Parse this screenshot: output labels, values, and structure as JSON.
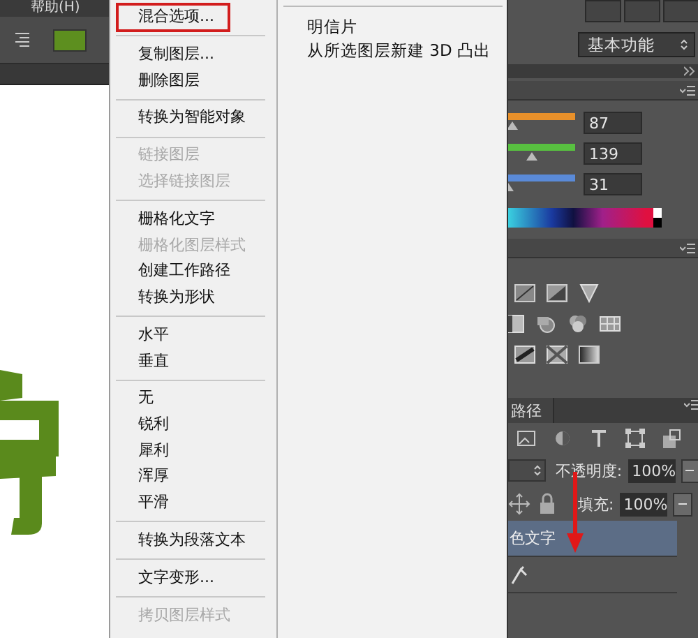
{
  "menubar": {
    "items": [
      "帮助(H)"
    ]
  },
  "context_menu": {
    "sections": [
      [
        {
          "label": "混合选项...",
          "disabled": false,
          "marked": true
        }
      ],
      [
        {
          "label": "复制图层...",
          "disabled": false,
          "marked": false
        },
        {
          "label": "删除图层",
          "disabled": false,
          "marked": false
        }
      ],
      [
        {
          "label": "转换为智能对象",
          "disabled": false,
          "marked": false
        }
      ],
      [
        {
          "label": "链接图层",
          "disabled": true,
          "marked": false
        },
        {
          "label": "选择链接图层",
          "disabled": true,
          "marked": false
        }
      ],
      [
        {
          "label": "栅格化文字",
          "disabled": false,
          "marked": false
        },
        {
          "label": "栅格化图层样式",
          "disabled": true,
          "marked": false
        },
        {
          "label": "创建工作路径",
          "disabled": false,
          "marked": false
        },
        {
          "label": "转换为形状",
          "disabled": false,
          "marked": false
        }
      ],
      [
        {
          "label": "水平",
          "disabled": false,
          "marked": false
        },
        {
          "label": "垂直",
          "disabled": false,
          "marked": false
        }
      ],
      [
        {
          "label": "无",
          "disabled": false,
          "marked": false
        },
        {
          "label": "锐利",
          "disabled": false,
          "marked": false
        },
        {
          "label": "犀利",
          "disabled": false,
          "marked": false
        },
        {
          "label": "浑厚",
          "disabled": false,
          "marked": false
        },
        {
          "label": "平滑",
          "disabled": false,
          "marked": false
        }
      ],
      [
        {
          "label": "转换为段落文本",
          "disabled": false,
          "marked": false
        }
      ],
      [
        {
          "label": "文字变形...",
          "disabled": false,
          "marked": false
        }
      ],
      [
        {
          "label": "拷贝图层样式",
          "disabled": true,
          "marked": false
        }
      ]
    ]
  },
  "submenu": {
    "items": [
      "明信片",
      "从所选图层新建 3D 凸出"
    ]
  },
  "workspace": {
    "value": "基本功能"
  },
  "color_panel": {
    "channels": [
      {
        "value": "87",
        "color": "#e8902a",
        "level": 0.06
      },
      {
        "value": "139",
        "color": "#58c040",
        "level": 0.35
      },
      {
        "value": "31",
        "color": "#5a8ad8",
        "level": 0
      }
    ]
  },
  "panel_tabs": [
    {
      "label": "路径",
      "selected": false
    }
  ],
  "layers": {
    "opacity_label": "不透明度:",
    "opacity": "100%",
    "fill_label": "填充:",
    "fill": "100%",
    "rows": [
      {
        "name": "色文字",
        "selected": true
      },
      {
        "selected": false
      }
    ]
  }
}
